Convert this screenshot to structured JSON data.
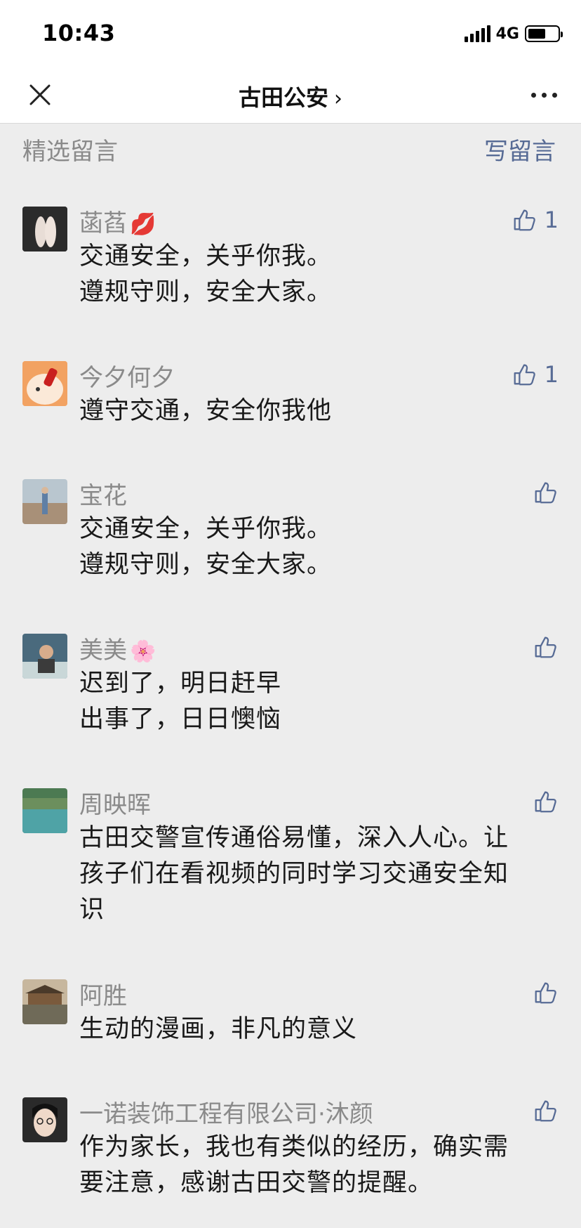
{
  "status_bar": {
    "time": "10:43",
    "network": "4G",
    "battery_level": 0.6
  },
  "nav": {
    "title": "古田公安",
    "chevron": "›"
  },
  "section": {
    "title": "精选留言",
    "write_label": "写留言"
  },
  "colors": {
    "accent": "#576b95",
    "nickname": "#8a8a8a",
    "text": "#191919",
    "background": "#ededed"
  },
  "comments": [
    {
      "nickname": "菡萏",
      "emoji": "💋",
      "lines": [
        "交通安全，关乎你我。",
        "遵规守则，安全大家。"
      ],
      "likes": "1"
    },
    {
      "nickname": "今夕何夕",
      "emoji": "",
      "lines": [
        "遵守交通，安全你我他"
      ],
      "likes": "1"
    },
    {
      "nickname": "宝花",
      "emoji": "",
      "lines": [
        "交通安全，关乎你我。",
        "遵规守则，安全大家。"
      ],
      "likes": ""
    },
    {
      "nickname": "美美",
      "emoji": "🌸",
      "lines": [
        "迟到了，明日赶早",
        "出事了，日日懊恼"
      ],
      "likes": ""
    },
    {
      "nickname": "周映晖",
      "emoji": "",
      "lines": [
        "古田交警宣传通俗易懂，深入人心。让",
        "孩子们在看视频的同时学习交通安全知",
        "识"
      ],
      "likes": ""
    },
    {
      "nickname": "阿胜",
      "emoji": "",
      "lines": [
        "生动的漫画，非凡的意义"
      ],
      "likes": ""
    },
    {
      "nickname": "一诺装饰工程有限公司·沐颜",
      "emoji": "",
      "lines": [
        "作为家长，我也有类似的经历，确实需",
        "要注意，感谢古田交警的提醒。"
      ],
      "likes": ""
    }
  ]
}
